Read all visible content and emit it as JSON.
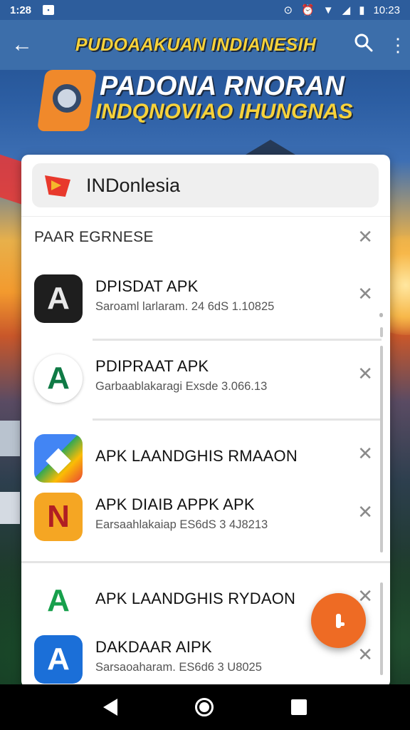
{
  "status_bar": {
    "time": "1:28",
    "right_time": "10:23",
    "icons": [
      "notification-icon",
      "location-icon",
      "alarm-icon",
      "wifi-icon",
      "signal-icon",
      "battery-icon"
    ]
  },
  "app_bar": {
    "title": "PUDOAAKUAN INDIANESIH",
    "back_icon": "back-arrow-icon",
    "search_icon": "search-icon",
    "more_icon": "more-vert-icon"
  },
  "banner": {
    "line1": "PADONA RNORAN",
    "line2": "INDQNOVIAO IHUNGNAS"
  },
  "search": {
    "query": "INDonlesia"
  },
  "section": {
    "heading": "PAAR EGRNESE"
  },
  "results": [
    {
      "name": "DPISDAT APK",
      "subtitle": "Saroaml larlaram. 24 6dS 1.10825",
      "icon_color": "#1e1e1e",
      "icon_glyph": "A",
      "icon_text_color": "#e8e8e8"
    },
    {
      "name": "PDIPRAAT APK",
      "subtitle": "Garbaablakaragi Exsde 3.066.13",
      "icon_color": "#ffffff",
      "icon_glyph": "A",
      "icon_text_color": "#0f7a45"
    },
    {
      "name": "APK LAANDGHIS RMAAON",
      "subtitle": "",
      "icon_color": "#ffffff",
      "icon_glyph": "◆",
      "icon_text_color": "#e84135"
    },
    {
      "name": "APK DIAIB APPK APK",
      "subtitle": "Earsaahlakaiap ES6dS 3 4J8213",
      "icon_color": "#f5a623",
      "icon_glyph": "N",
      "icon_text_color": "#b01e23"
    },
    {
      "name": "APK LAANDGHIS RYDAON",
      "subtitle": "",
      "icon_color": "#ffffff",
      "icon_glyph": "A",
      "icon_text_color": "#17a04c"
    },
    {
      "name": "DAKDAAR AIPK",
      "subtitle": "Sarsaoaharam. ES6d6 3 U8025",
      "icon_color": "#1b6fd8",
      "icon_glyph": "A",
      "icon_text_color": "#ffffff"
    }
  ],
  "accent_colors": {
    "fab": "#ee6b24",
    "app_bar": "#3c6eaa",
    "title_text": "#f7d23a"
  }
}
